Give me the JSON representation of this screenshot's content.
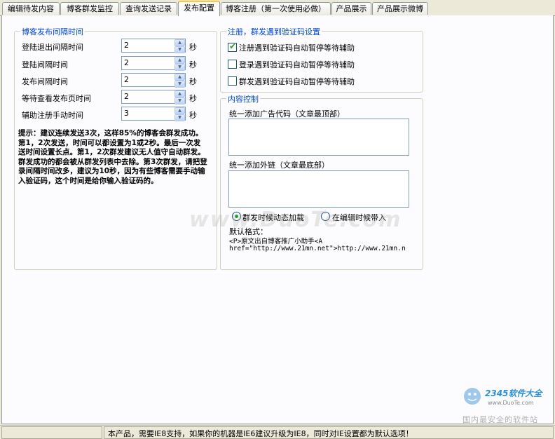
{
  "tabs": [
    {
      "label": "编辑待发内容",
      "active": false
    },
    {
      "label": "博客群发监控",
      "active": false
    },
    {
      "label": "查询发送记录",
      "active": false
    },
    {
      "label": "发布配置",
      "active": true
    },
    {
      "label": "博客注册（第一次使用必做）",
      "active": false
    },
    {
      "label": "产品展示",
      "active": false
    },
    {
      "label": "产品展示微博",
      "active": false
    }
  ],
  "interval_group": {
    "title": "博客发布间隔时间",
    "rows": [
      {
        "label": "登陆退出间隔时间",
        "value": "2",
        "unit": "秒"
      },
      {
        "label": "登陆间隔时间",
        "value": "2",
        "unit": "秒"
      },
      {
        "label": "发布间隔时间",
        "value": "2",
        "unit": "秒"
      },
      {
        "label": "等待查看发布页时间",
        "value": "2",
        "unit": "秒"
      },
      {
        "label": "辅助注册手动时间",
        "value": "3",
        "unit": "秒"
      }
    ],
    "tip": "提示：建议连续发送3次，这样85%的博客会群发成功。第1，2次发送，时间可以都设置为1或2秒。最后一次发送时间设置长点。第1，2次群发建议无人值守自动群发。群发成功的都会被从群发列表中去除。第3次群发，请把登录间隔时间改多，建议为10秒，因为有些博客需要手动输入验证码，这个时间是给你输入验证码的。"
  },
  "captcha_group": {
    "title": "注册，群发遇到验证码设置",
    "options": [
      {
        "label": "注册遇到验证码自动暂停等待辅助",
        "checked": true
      },
      {
        "label": "登录遇到验证码自动暂停等待辅助",
        "checked": false
      },
      {
        "label": "群发遇到验证码自动暂停等待辅助",
        "checked": false
      }
    ]
  },
  "content_group": {
    "title": "内容控制",
    "ad_label": "统一添加广告代码（文章最顶部）",
    "ad_value": "",
    "link_label": "统一添加外链（文章最底部）",
    "link_value": "",
    "radios": [
      {
        "label": "群发时候动态加载",
        "selected": true
      },
      {
        "label": "在编辑时候带入",
        "selected": false
      }
    ],
    "default_format_label": "默认格式：",
    "default_format_line1": "<P>原文出自博客推广小助手<A",
    "default_format_line2": "href=\"http://www.21mn.net\">http://www.21mn.n"
  },
  "watermark": "www.DuoTe.com",
  "status_bar": {
    "text": "本产品，需要IE8支持，如果你的机器是IE6建议升级为IE8，同时对IE设置都为默认选项！"
  },
  "brand": {
    "name": "2345软件大全",
    "url": "www.DuoTe.com",
    "slogan": "国内最安全的软件站"
  }
}
